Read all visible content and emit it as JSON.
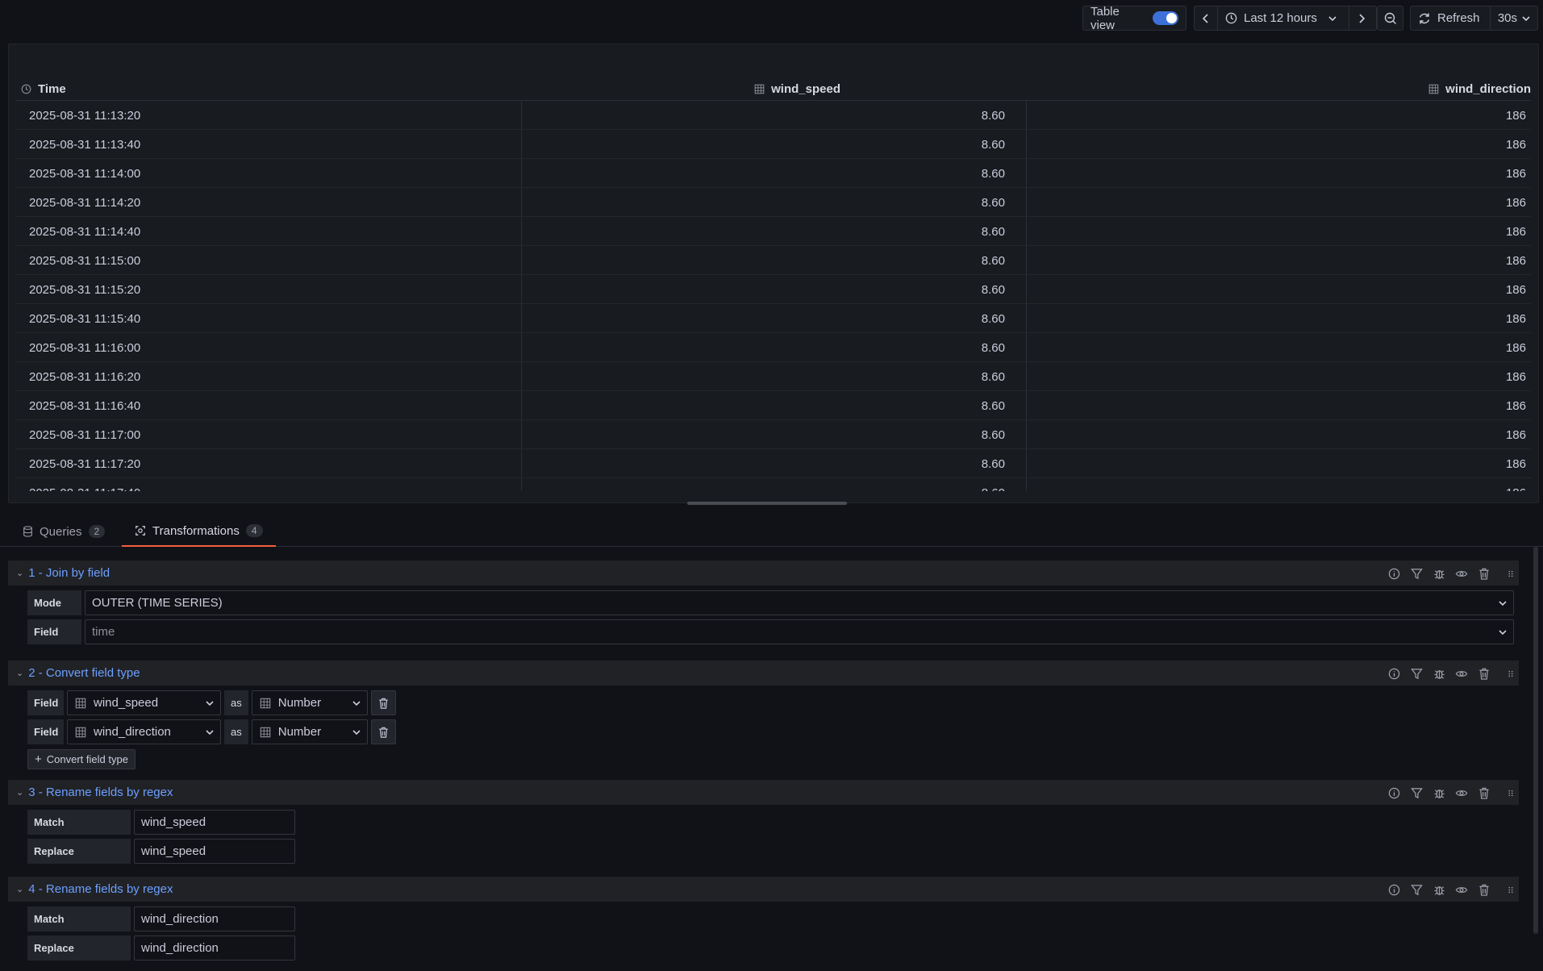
{
  "toolbar": {
    "table_view_label": "Table view",
    "time_range": "Last 12 hours",
    "refresh_label": "Refresh",
    "refresh_interval": "30s"
  },
  "table": {
    "columns": [
      "Time",
      "wind_speed",
      "wind_direction"
    ],
    "rows": [
      [
        "2025-08-31 11:13:20",
        "8.60",
        "186"
      ],
      [
        "2025-08-31 11:13:40",
        "8.60",
        "186"
      ],
      [
        "2025-08-31 11:14:00",
        "8.60",
        "186"
      ],
      [
        "2025-08-31 11:14:20",
        "8.60",
        "186"
      ],
      [
        "2025-08-31 11:14:40",
        "8.60",
        "186"
      ],
      [
        "2025-08-31 11:15:00",
        "8.60",
        "186"
      ],
      [
        "2025-08-31 11:15:20",
        "8.60",
        "186"
      ],
      [
        "2025-08-31 11:15:40",
        "8.60",
        "186"
      ],
      [
        "2025-08-31 11:16:00",
        "8.60",
        "186"
      ],
      [
        "2025-08-31 11:16:20",
        "8.60",
        "186"
      ],
      [
        "2025-08-31 11:16:40",
        "8.60",
        "186"
      ],
      [
        "2025-08-31 11:17:00",
        "8.60",
        "186"
      ],
      [
        "2025-08-31 11:17:20",
        "8.60",
        "186"
      ],
      [
        "2025-08-31 11:17:40",
        "8.60",
        "186"
      ]
    ]
  },
  "tabs": [
    {
      "label": "Queries",
      "count": "2"
    },
    {
      "label": "Transformations",
      "count": "4"
    }
  ],
  "transformations": {
    "t1": {
      "title": "1 - Join by field",
      "mode_label": "Mode",
      "mode_value": "OUTER (TIME SERIES)",
      "field_label": "Field",
      "field_placeholder": "time"
    },
    "t2": {
      "title": "2 - Convert field type",
      "field_label": "Field",
      "as_label": "as",
      "rows": [
        {
          "field": "wind_speed",
          "type": "Number"
        },
        {
          "field": "wind_direction",
          "type": "Number"
        }
      ],
      "add_label": "Convert field type"
    },
    "t3": {
      "title": "3 - Rename fields by regex",
      "match_label": "Match",
      "match_value": "wind_speed",
      "replace_label": "Replace",
      "replace_value": "wind_speed"
    },
    "t4": {
      "title": "4 - Rename fields by regex",
      "match_label": "Match",
      "match_value": "wind_direction",
      "replace_label": "Replace",
      "replace_value": "wind_direction"
    }
  },
  "icons": [
    "clock-icon",
    "table-icon",
    "info-icon",
    "filter-icon",
    "bug-icon",
    "eye-icon",
    "trash-icon",
    "drag-handle-icon",
    "database-icon",
    "transform-icon",
    "refresh-icon",
    "zoom-out-icon",
    "chevron-left-icon",
    "chevron-right-icon",
    "chevron-down-icon",
    "plus-icon"
  ],
  "colors": {
    "accent": "#3d71d9",
    "link": "#6e9fff",
    "active_tab": "#f55f3e"
  }
}
